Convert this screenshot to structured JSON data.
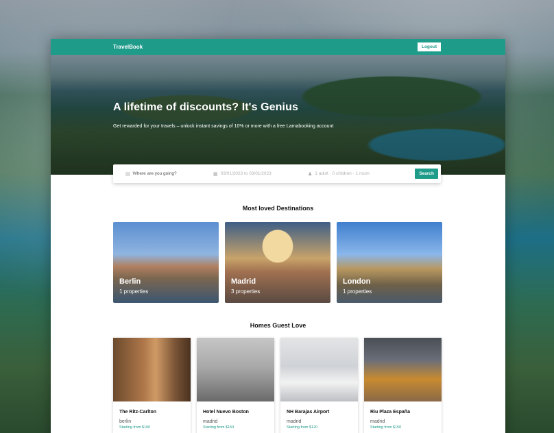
{
  "nav": {
    "brand": "TravelBook",
    "logout": "Logout"
  },
  "hero": {
    "title": "A lifetime of discounts? It's Genius",
    "subtitle": "Get rewarded for your travels – unlock instant savings of 10% or more with a free Lamabooking account"
  },
  "search": {
    "destination_placeholder": "Where are you going?",
    "dates": "03/01/2023 to 03/01/2023",
    "guests": "1 adult · 0 children · 1 room",
    "button": "Search"
  },
  "destinations": {
    "title": "Most loved Destinations",
    "items": [
      {
        "name": "Berlin",
        "count": "1 properties"
      },
      {
        "name": "Madrid",
        "count": "3 properties"
      },
      {
        "name": "London",
        "count": "1 properties"
      }
    ]
  },
  "homes": {
    "title": "Homes Guest Love",
    "items": [
      {
        "name": "The Ritz-Carlton",
        "city": "berlin",
        "price": "Starting from $100"
      },
      {
        "name": "Hotel Nuevo Boston",
        "city": "madrid",
        "price": "Starting from $150"
      },
      {
        "name": "NH Barajas Airport",
        "city": "madrid",
        "price": "Starting from $120"
      },
      {
        "name": "Riu Plaza España",
        "city": "madrid",
        "price": "Starting from $150"
      }
    ]
  }
}
